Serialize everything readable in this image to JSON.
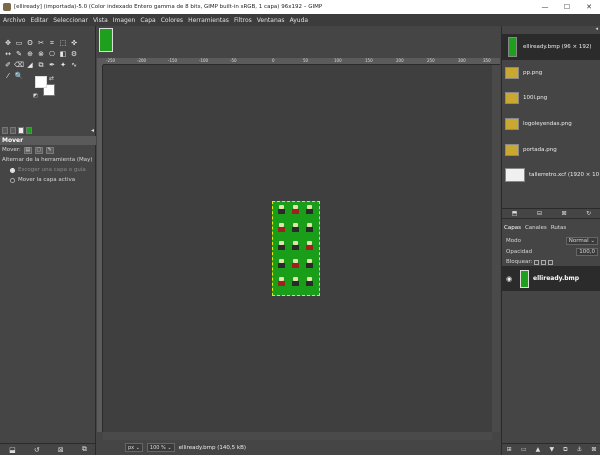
{
  "window": {
    "title": "[elliready] (importada)-5.0 (Color indexado Entero gamma de 8 bits, GIMP built-in sRGB, 1 capa) 96x192 – GIMP",
    "minimize": "—",
    "maximize": "☐",
    "close": "✕"
  },
  "menu": [
    "Archivo",
    "Editar",
    "Seleccionar",
    "Vista",
    "Imagen",
    "Capa",
    "Colores",
    "Herramientas",
    "Filtros",
    "Ventanas",
    "Ayuda"
  ],
  "toolbox": {
    "tools": [
      "✥",
      "▭",
      "ʘ",
      "✂",
      "⌗",
      "⬚",
      "✜",
      "↔",
      "✎",
      "⊕",
      "⊗",
      "⎔",
      "◧",
      "⚙",
      "✐",
      "⌫",
      "◢",
      "⧉",
      "✒",
      "✦",
      "∿",
      "⁄",
      "🔍"
    ],
    "options_header": "Mover",
    "move_label": "Mover:",
    "toggle_label": "Alternar de la herramienta  (May)",
    "radio1": "Escoger una capa o guía",
    "radio2": "Mover la capa activa",
    "bottom_buttons": [
      "⬓",
      "↺",
      "⊠",
      "⧉"
    ]
  },
  "canvas": {
    "ruler_ticks": [
      "-250",
      "-200",
      "-150",
      "-100",
      "-50",
      "0",
      "50",
      "100",
      "150",
      "200",
      "250",
      "300",
      "350"
    ]
  },
  "statusbar": {
    "unit": "px",
    "zoom": "100 %",
    "filename": "elliready.bmp (140,5 kB)"
  },
  "images": [
    {
      "label": "elliready.bmp (96 × 192)",
      "thumb": "tall",
      "selected": true
    },
    {
      "label": "pp.png",
      "thumb": "normal",
      "selected": false
    },
    {
      "label": "100l.png",
      "thumb": "normal",
      "selected": false
    },
    {
      "label": "logoleyendas.png",
      "thumb": "normal",
      "selected": false
    },
    {
      "label": "portada.png",
      "thumb": "normal",
      "selected": false
    },
    {
      "label": "tallerretro.xcf (1920 × 10",
      "thumb": "wide",
      "selected": false
    }
  ],
  "layers": {
    "tabs": [
      "Capas",
      "Canales",
      "Rutas"
    ],
    "mode_label": "Modo",
    "mode_value": "Normal",
    "opacity_label": "Opacidad",
    "opacity_value": "100,0",
    "lock_label": "Bloquear:",
    "layer_name": "elliready.bmp"
  }
}
